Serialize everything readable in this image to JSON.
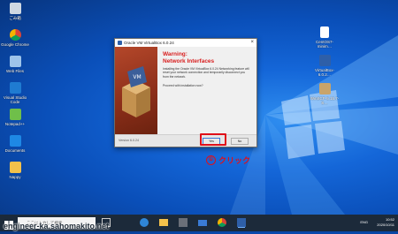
{
  "desktop": {
    "icons_left": [
      {
        "label": "ごみ箱",
        "icon": "recycle-bin-icon"
      },
      {
        "label": "Google Chrome",
        "icon": "chrome-icon"
      },
      {
        "label": "Web Files",
        "icon": "folder-icon"
      },
      {
        "label": "Visual Studio Code",
        "icon": "vscode-icon"
      },
      {
        "label": "Notepad++",
        "icon": "notepad-plus-icon"
      },
      {
        "label": "Documents",
        "icon": "folder-icon"
      },
      {
        "label": "Nappy",
        "icon": "folder-icon"
      }
    ],
    "icons_right": [
      {
        "label": "CentOS7-minim…",
        "icon": "file-icon"
      },
      {
        "label": "VirtualBox-6.0.2…",
        "icon": "virtualbox-icon"
      },
      {
        "label": "WinSCP-5.15.7-S…",
        "icon": "installer-box-icon"
      }
    ]
  },
  "dialog": {
    "title": "Oracle VM VirtualBox 6.0.24",
    "heading_line1": "Warning:",
    "heading_line2": "Network Interfaces",
    "body": "Installing the Oracle VM VirtualBox 6.0.24 Networking feature will reset your network connection and temporarily disconnect you from the network.",
    "prompt": "Proceed with installation now?",
    "version": "Version 6.0.24",
    "yes_label": "Yes",
    "no_label": "No"
  },
  "annotation": {
    "number": "①",
    "text": "クリック"
  },
  "taskbar": {
    "search_placeholder": "ここに入力して検索",
    "time": "10:52",
    "date": "2020/10/11",
    "ime": "ENG"
  },
  "watermark": "engineer-ka.sahomakito.net",
  "colors": {
    "accent_red": "#e0101a",
    "warning_red": "#d81e1e",
    "desktop_blue": "#1466d8",
    "taskbar": "#1c2a3a"
  }
}
